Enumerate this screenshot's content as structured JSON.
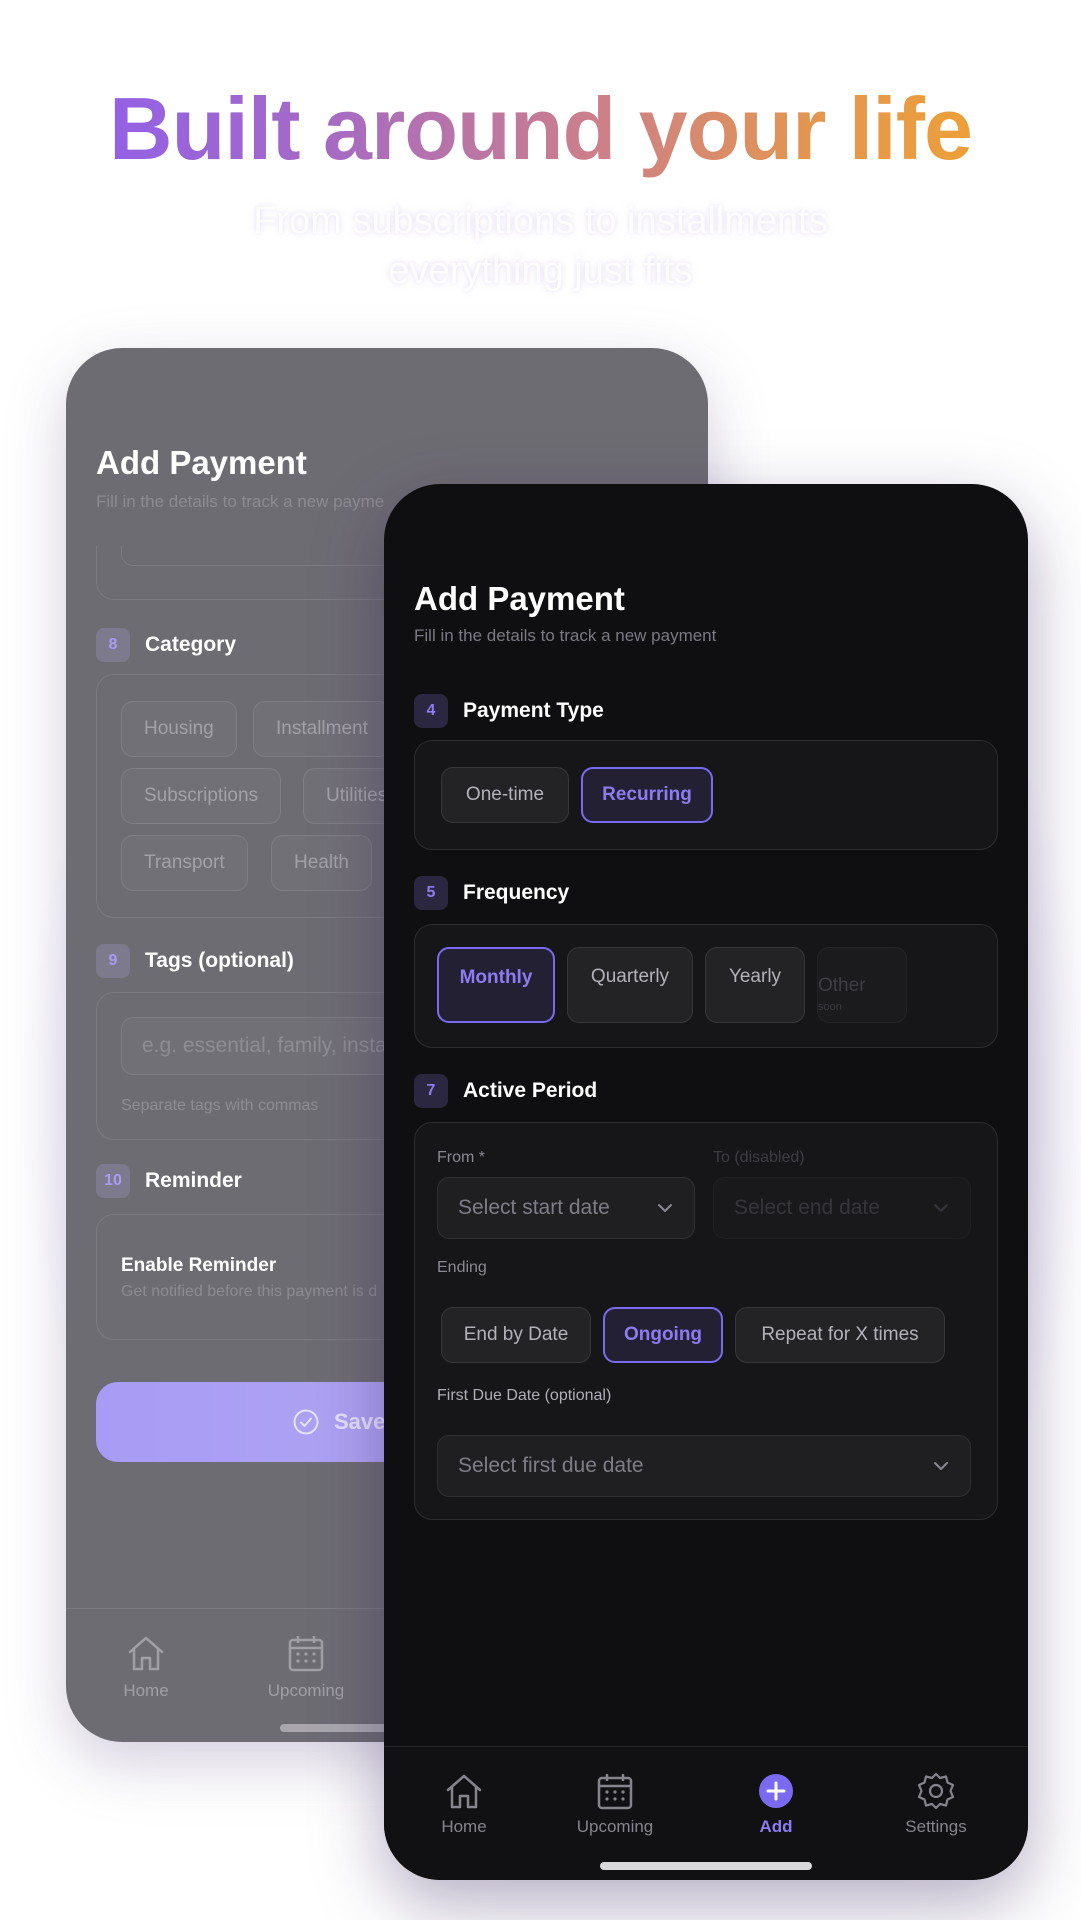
{
  "hero": {
    "headline": "Built around your life",
    "subtitle_line1": "From subscriptions to installments",
    "subtitle_line2": "everything just fits"
  },
  "colors": {
    "accent": "#7b6af0",
    "gradient_start": "#8b5cf6",
    "gradient_end": "#f3a628",
    "front_bg": "#0f0f11",
    "back_bg": "#6e6c73"
  },
  "back_phone": {
    "title": "Add Payment",
    "subtitle": "Fill in the details to track a new payme",
    "category": {
      "number": "8",
      "label": "Category",
      "chips": [
        "Housing",
        "Installment",
        "Subscriptions",
        "Utilities",
        "Transport",
        "Health"
      ]
    },
    "tags": {
      "number": "9",
      "label": "Tags (optional)",
      "placeholder": "e.g. essential, family, insta",
      "hint": "Separate tags with commas"
    },
    "reminder": {
      "number": "10",
      "label": "Reminder",
      "toggle_title": "Enable Reminder",
      "toggle_sub": "Get notified before this payment is d"
    },
    "save_label": "Save",
    "nav": [
      {
        "label": "Home",
        "icon": "home-icon"
      },
      {
        "label": "Upcoming",
        "icon": "calendar-icon"
      }
    ]
  },
  "front_phone": {
    "title": "Add Payment",
    "subtitle": "Fill in the details to track a new payment",
    "payment_type": {
      "number": "4",
      "label": "Payment Type",
      "options": [
        "One-time",
        "Recurring"
      ],
      "selected": "Recurring"
    },
    "frequency": {
      "number": "5",
      "label": "Frequency",
      "options": [
        "Monthly",
        "Quarterly",
        "Yearly",
        "Other"
      ],
      "other_note": "soon",
      "selected": "Monthly"
    },
    "active_period": {
      "number": "7",
      "label": "Active Period",
      "from_label": "From *",
      "from_placeholder": "Select start date",
      "to_label": "To (disabled)",
      "to_placeholder": "Select end date",
      "ending_label": "Ending",
      "ending_options": [
        "End by Date",
        "Ongoing",
        "Repeat for X times"
      ],
      "ending_selected": "Ongoing",
      "first_due_label": "First Due Date (optional)",
      "first_due_placeholder": "Select first due date"
    },
    "nav": [
      {
        "label": "Home",
        "icon": "home-icon"
      },
      {
        "label": "Upcoming",
        "icon": "calendar-icon"
      },
      {
        "label": "Add",
        "icon": "plus-circle-icon",
        "active": true
      },
      {
        "label": "Settings",
        "icon": "gear-icon"
      }
    ]
  }
}
